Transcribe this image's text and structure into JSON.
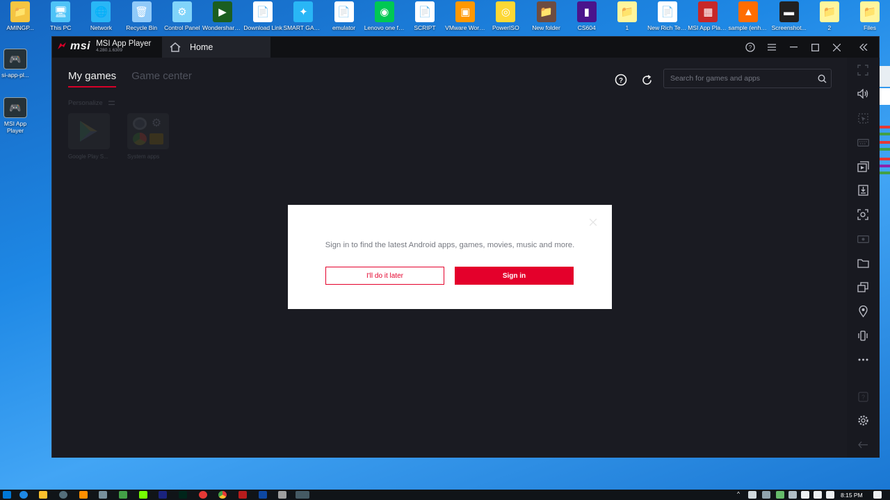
{
  "desktop": {
    "top_icons": [
      {
        "label": "AMINGP...",
        "color": "#f5c542",
        "glyph": "📁"
      },
      {
        "label": "This PC",
        "color": "#4fc3f7",
        "glyph": "🖥"
      },
      {
        "label": "Network",
        "color": "#29b6f6",
        "glyph": "🌐"
      },
      {
        "label": "Recycle Bin",
        "color": "#90caf9",
        "glyph": "🗑"
      },
      {
        "label": "Control Panel",
        "color": "#81d4fa",
        "glyph": "⚙"
      },
      {
        "label": "Wondershare Filmora12",
        "color": "#1b5e20",
        "glyph": "▶"
      },
      {
        "label": "Download Link",
        "color": "#ffffff",
        "glyph": "📄"
      },
      {
        "label": "SMART GAGA LITE",
        "color": "#29b6f6",
        "glyph": "✦"
      },
      {
        "label": "emulator",
        "color": "#ffffff",
        "glyph": "📄"
      },
      {
        "label": "Lenovo one fusion ap...",
        "color": "#00c853",
        "glyph": "◉"
      },
      {
        "label": "SCRIPT",
        "color": "#ffffff",
        "glyph": "📄"
      },
      {
        "label": "VMware Workstati...",
        "color": "#ff9800",
        "glyph": "▣"
      },
      {
        "label": "PowerISO",
        "color": "#fdd835",
        "glyph": "◎"
      },
      {
        "label": "New folder",
        "color": "#6d4c41",
        "glyph": "📁"
      },
      {
        "label": "CS604",
        "color": "#4a148c",
        "glyph": "▮"
      },
      {
        "label": "1",
        "color": "#fff59d",
        "glyph": "📁"
      },
      {
        "label": "New Rich Text Doc...",
        "color": "#ffffff",
        "glyph": "📄"
      },
      {
        "label": "MSI App Player 5.12...",
        "color": "#c62828",
        "glyph": "▦"
      },
      {
        "label": "sample (enhanced)",
        "color": "#ff6d00",
        "glyph": "▲"
      },
      {
        "label": "Screenshot...",
        "color": "#212121",
        "glyph": "▬"
      },
      {
        "label": "2",
        "color": "#fff59d",
        "glyph": "📁"
      },
      {
        "label": "Files",
        "color": "#fff59d",
        "glyph": "📁"
      }
    ],
    "left_icons": [
      {
        "label": "si-app-pl..."
      },
      {
        "label": "MSI App Player"
      }
    ]
  },
  "window": {
    "app_name": "MSI App Player",
    "brand": "msi",
    "version": "4.280.1.6309",
    "home_tab": "Home"
  },
  "tabs": {
    "my_games": "My games",
    "game_center": "Game center"
  },
  "search": {
    "placeholder": "Search for games and apps"
  },
  "library": {
    "personalize": "Personalize",
    "apps": [
      {
        "name": "Google Play S..."
      },
      {
        "name": "System apps"
      }
    ]
  },
  "dialog": {
    "message": "Sign in to find the latest Android apps, games, movies, music and more.",
    "later_label": "I'll do it later",
    "signin_label": "Sign in"
  },
  "taskbar": {
    "time": "8:15 PM"
  },
  "colors": {
    "accent": "#e4002b",
    "bg": "#1c1d24",
    "titlebar": "#111216"
  }
}
